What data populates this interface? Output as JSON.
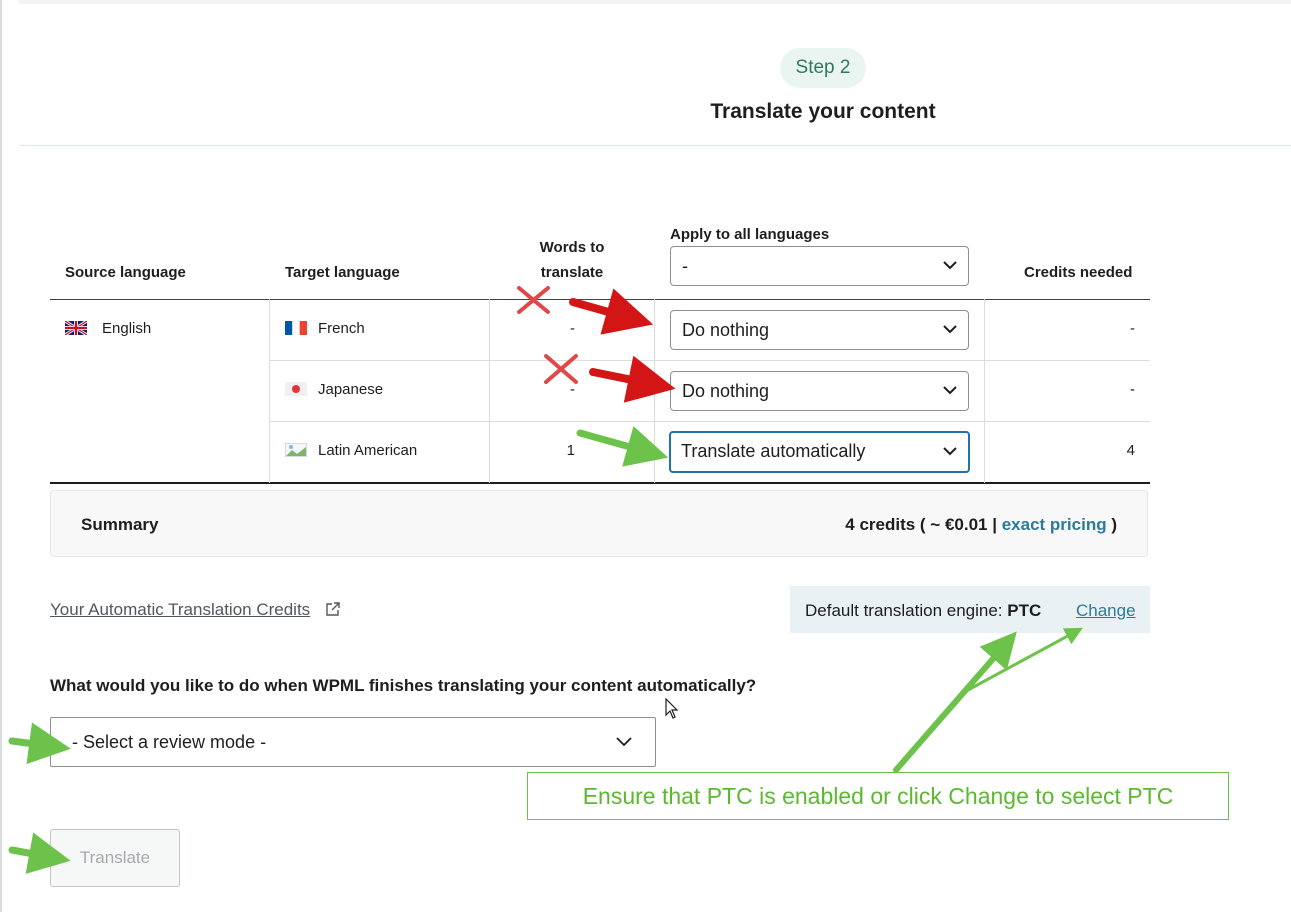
{
  "step": {
    "badge": "Step 2",
    "title": "Translate your content"
  },
  "table": {
    "headers": {
      "source": "Source language",
      "target": "Target language",
      "words_line1": "Words to",
      "words_line2": "translate",
      "apply_all": "Apply to all languages",
      "credits": "Credits needed"
    },
    "apply_all_value": "-",
    "source_language": "English",
    "rows": [
      {
        "language": "French",
        "words": "-",
        "action": "Do nothing",
        "credits": "-"
      },
      {
        "language": "Japanese",
        "words": "-",
        "action": "Do nothing",
        "credits": "-"
      },
      {
        "language": "Latin American",
        "words": "1",
        "action": "Translate automatically",
        "credits": "4"
      }
    ]
  },
  "summary": {
    "label": "Summary",
    "credits_text": "4 credits ( ~ €0.01 |",
    "pricing_link": "exact pricing",
    "close_paren": ")"
  },
  "credits_link": "Your Automatic Translation Credits",
  "engine": {
    "label": "Default translation engine:",
    "name": "PTC",
    "change": "Change"
  },
  "review": {
    "question": "What would you like to do when WPML finishes translating your content automatically?",
    "placeholder": "- Select a review mode -"
  },
  "translate_button": "Translate",
  "annotation": {
    "callout": "Ensure that PTC is enabled or click Change to select PTC"
  },
  "colors": {
    "accent": "#2d7a9a",
    "focus": "#2271b1",
    "green_annotation": "#5cb82f",
    "red_annotation": "#d31515"
  },
  "icons": [
    "uk-flag-icon",
    "france-flag-icon",
    "japan-flag-icon",
    "latin-america-flag-icon",
    "chevron-down-icon",
    "external-link-icon",
    "cursor-icon"
  ]
}
